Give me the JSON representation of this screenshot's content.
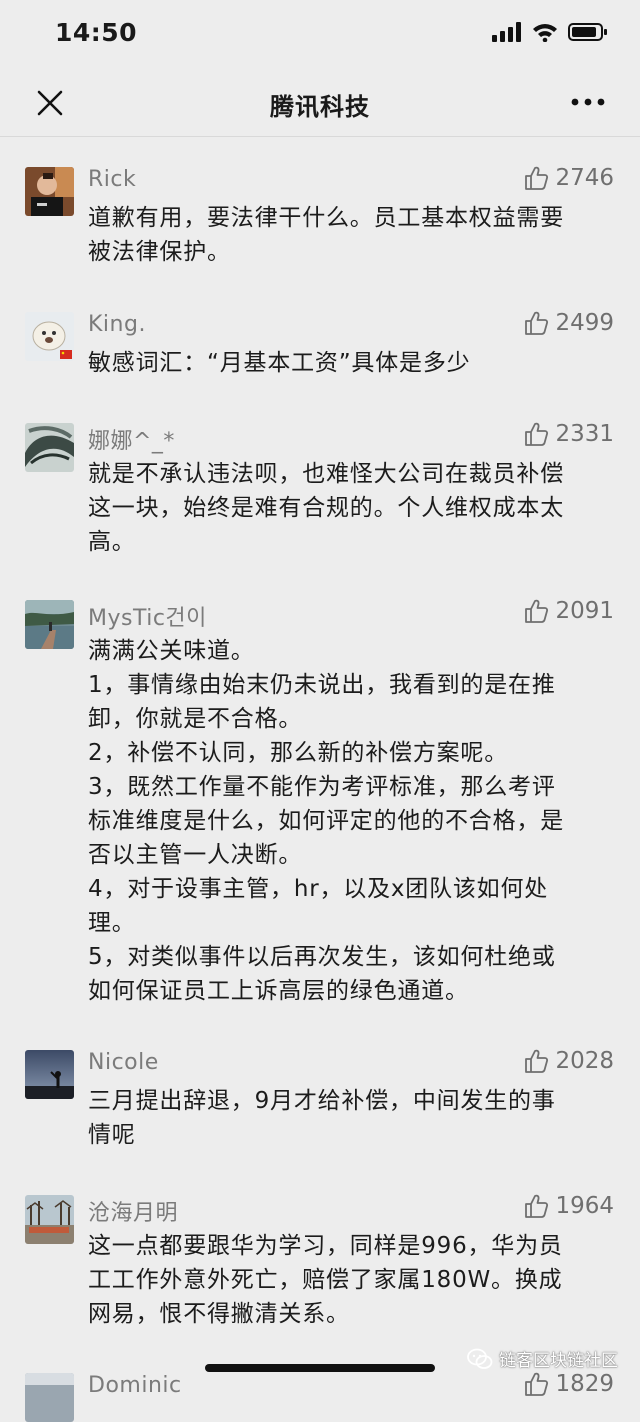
{
  "status_bar": {
    "time": "14:50"
  },
  "nav": {
    "title": "腾讯科技"
  },
  "comments": [
    {
      "name": "Rick",
      "likes": "2746",
      "lines": [
        "道歉有用，要法律干什么。员工基本权益需要",
        "被法律保护。"
      ]
    },
    {
      "name": "King.",
      "likes": "2499",
      "lines": [
        "敏感词汇：“月基本工资”具体是多少"
      ]
    },
    {
      "name": "娜娜^_*",
      "likes": "2331",
      "lines": [
        "就是不承认违法呗，也难怪大公司在裁员补偿",
        "这一块，始终是难有合规的。个人维权成本太",
        "高。"
      ]
    },
    {
      "name": "MysTic건이",
      "likes": "2091",
      "lines": [
        "满满公关味道。",
        "1，事情缘由始末仍未说出，我看到的是在推",
        "卸，你就是不合格。",
        "2，补偿不认同，那么新的补偿方案呢。",
        "3，既然工作量不能作为考评标准，那么考评",
        "标准维度是什么，如何评定的他的不合格，是",
        "否以主管一人决断。",
        "4，对于设事主管，hr，以及x团队该如何处",
        "理。",
        "5，对类似事件以后再次发生，该如何杜绝或",
        "如何保证员工上诉高层的绿色通道。"
      ]
    },
    {
      "name": "Nicole",
      "likes": "2028",
      "lines": [
        "三月提出辞退，9月才给补偿，中间发生的事",
        "情呢"
      ]
    },
    {
      "name": "沧海月明",
      "likes": "1964",
      "lines": [
        "这一点都要跟华为学习，同样是996，华为员",
        "工工作外意外死亡，赔偿了家属180W。换成",
        "网易，恨不得撇清关系。"
      ]
    },
    {
      "name": "Dominic",
      "likes": "1829",
      "lines": []
    }
  ],
  "watermark": {
    "text": "链客区块链社区"
  }
}
